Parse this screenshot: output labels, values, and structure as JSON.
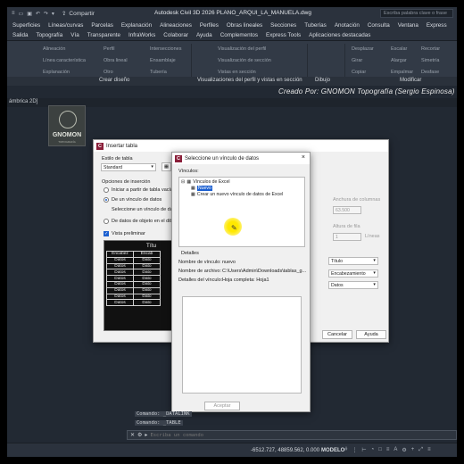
{
  "app": {
    "title": "Autodesk Civil 3D 2026   PLANO_ARQUI_LA_MANUELA.dwg",
    "share_label": "Compartir",
    "search_placeholder": "Escriba palabra clave o frase"
  },
  "menubar1": [
    "Superficies",
    "Líneas/curvas",
    "Parcelas",
    "Explanación",
    "Alineaciones",
    "Perfiles",
    "Obras lineales",
    "Secciones",
    "Tuberías",
    "Anotación",
    "Consulta",
    "Ventana",
    "Express"
  ],
  "menubar2": [
    "Salida",
    "Topografía",
    "Vía",
    "Transparente",
    "InfraWorks",
    "Colaborar",
    "Ayuda",
    "Complementos",
    "Express Tools",
    "Aplicaciones destacadas"
  ],
  "ribbon": {
    "items": [
      "Alineación",
      "Línea característica",
      "Explanación",
      "Perfil",
      "Obra lineal",
      "Otro",
      "Intersecciones",
      "Ensamblaje",
      "Tubería",
      "Visualización del perfil",
      "Visualización de sección",
      "Vistas en sección",
      "Desplazar",
      "Girar",
      "Copiar",
      "Escalar",
      "Recortar",
      "Alargar",
      "Simetría",
      "Empalmar",
      "Desfase"
    ],
    "panels": [
      "Crear diseño",
      "Visualizaciones del perfil y vistas en sección",
      "Dibujo",
      "Modificar"
    ]
  },
  "drawing": {
    "credit": "Creado Por: GNOMON Topografía (Sergio Espinosa)",
    "tab_label": "ámbrica 2D]",
    "logo_text": "GNOMON",
    "logo_sub": "TOPOGRAFÍA"
  },
  "insert_table": {
    "title": "Insertar tabla",
    "style_label": "Estilo de tabla",
    "style_value": "Standard",
    "insert_options_label": "Opciones de inserción",
    "opt_empty": "Iniciar a partir de tabla vacía",
    "opt_link": "De un vínculo de datos",
    "opt_link_hint": "Seleccione un vínculo de datos",
    "opt_objects": "De datos de objeto en el dibujo",
    "preview_label": "Vista preliminar",
    "preview_title": "Títu",
    "preview_rows": [
      [
        "Encabez",
        "Encab"
      ],
      [
        "Datos",
        "Dato"
      ],
      [
        "Datos",
        "Dato"
      ],
      [
        "Datos",
        "Dato"
      ],
      [
        "Datos",
        "Dato"
      ],
      [
        "Datos",
        "Dato"
      ],
      [
        "Datos",
        "Dato"
      ],
      [
        "Datos",
        "Dato"
      ],
      [
        "Datos",
        "Dato"
      ]
    ],
    "col_width_label": "Anchura de columnas",
    "col_width_value": "63.500",
    "row_height_label": "Altura de fila",
    "row_height_value": "1",
    "rows_unit": "Líneas",
    "row1_style": "Título",
    "row2_style": "Encabezamiento",
    "row3_style": "Datos",
    "cancel_label": "Cancelar",
    "help_label": "Ayuda"
  },
  "data_link": {
    "title": "Seleccione un vínculo de datos",
    "links_label": "Vínculos:",
    "tree_root": "Vínculos de Excel",
    "tree_new": "Nuevo",
    "tree_create": "Crear un nuevo vínculo de datos de Excel",
    "details_label": "Detalles",
    "name_label": "Nombre de vínculo:",
    "name_value": "nuevo",
    "file_label": "Nombre de archivo:",
    "file_value": "C:\\Users\\Admin\\Downloads\\tablas_g...",
    "detail_label": "Detalles del vínculo:",
    "detail_value": "Hoja completa: Hoja1",
    "accept_label": "Aceptar"
  },
  "command": {
    "history": [
      "Comando: _DATALINK",
      "Comando: _TABLE"
    ],
    "placeholder": "Escriba un comando"
  },
  "status": {
    "coords": "-6512.727, 48859.562, 0.000",
    "mode": "MODELO"
  }
}
